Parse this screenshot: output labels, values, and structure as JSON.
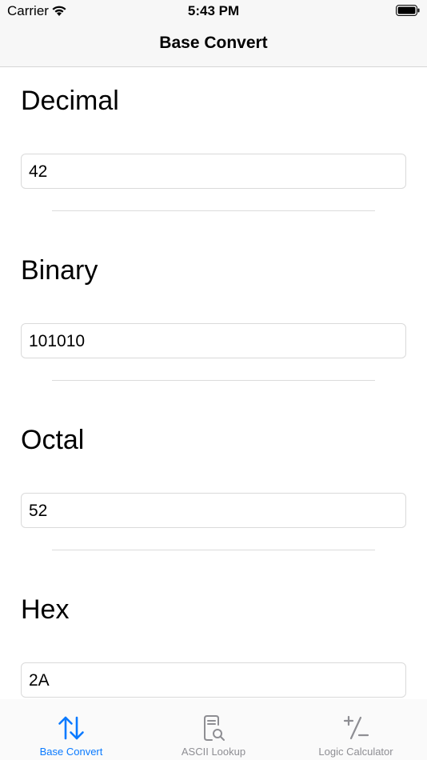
{
  "status_bar": {
    "carrier": "Carrier",
    "time": "5:43 PM"
  },
  "nav": {
    "title": "Base Convert"
  },
  "sections": [
    {
      "label": "Decimal",
      "value": "42"
    },
    {
      "label": "Binary",
      "value": "101010"
    },
    {
      "label": "Octal",
      "value": "52"
    },
    {
      "label": "Hex",
      "value": "2A"
    }
  ],
  "tab_bar": {
    "active_color": "#0a7aff",
    "inactive_color": "#8e8e93",
    "tabs": [
      {
        "label": "Base Convert",
        "icon": "arrows-up-down-icon",
        "active": true
      },
      {
        "label": "ASCII Lookup",
        "icon": "document-search-icon",
        "active": false
      },
      {
        "label": "Logic Calculator",
        "icon": "plus-slash-minus-icon",
        "active": false
      }
    ]
  }
}
